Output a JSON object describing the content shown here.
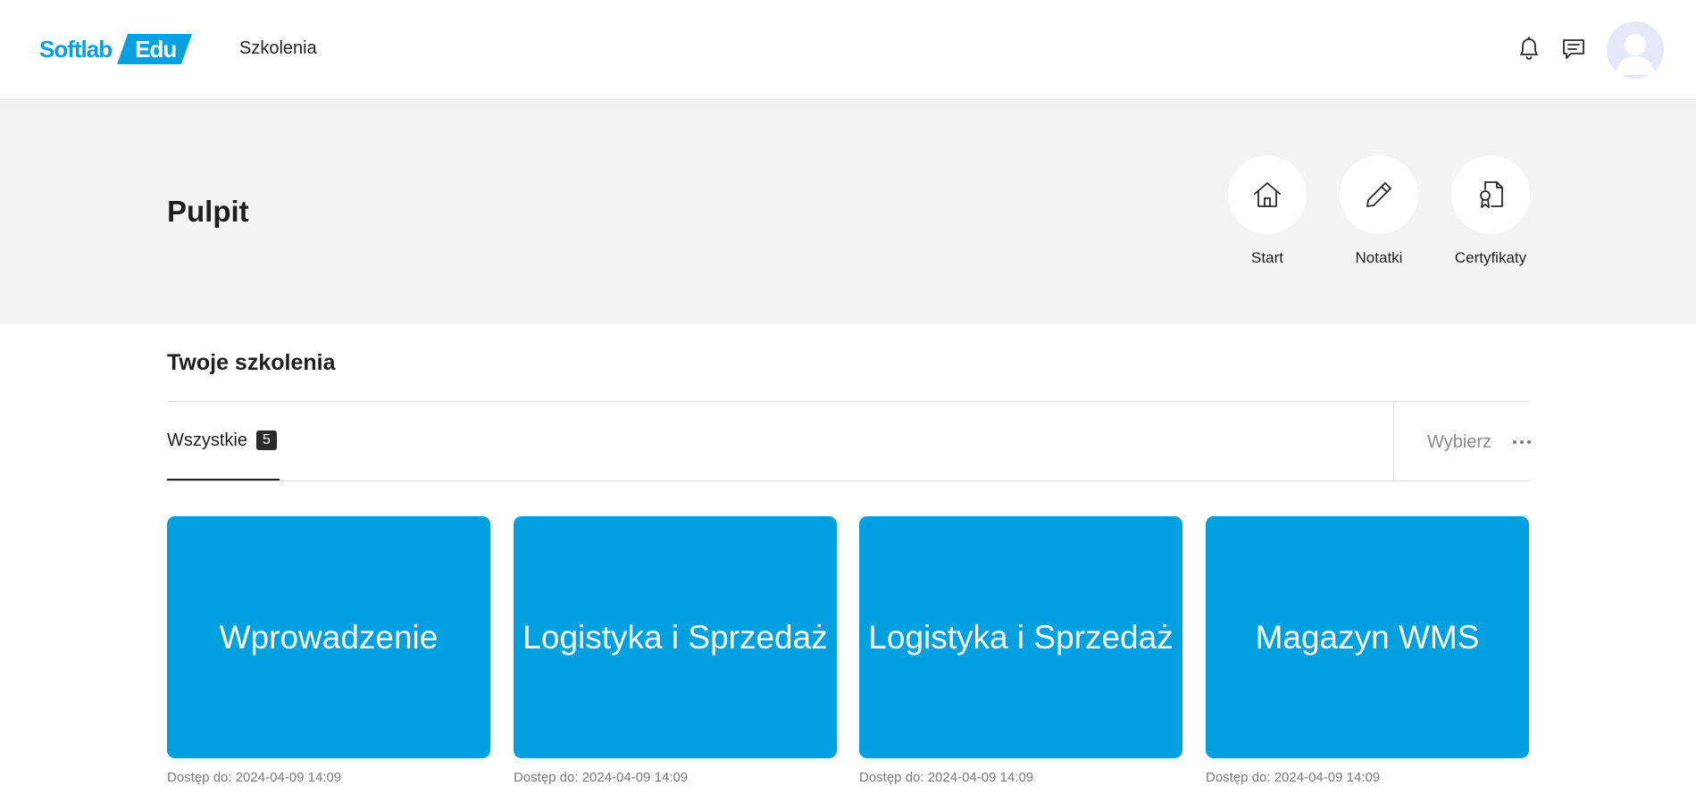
{
  "header": {
    "logo_part1": "Softlab",
    "logo_part2": "Edu",
    "nav_link": "Szkolenia",
    "icons": [
      "bell-icon",
      "chat-icon",
      "avatar"
    ]
  },
  "band": {
    "title": "Pulpit",
    "quick_links": [
      {
        "label": "Start",
        "icon": "home-icon"
      },
      {
        "label": "Notatki",
        "icon": "pencil-icon"
      },
      {
        "label": "Certyfikaty",
        "icon": "certificate-icon"
      }
    ]
  },
  "trainings": {
    "title": "Twoje szkolenia",
    "tab_label": "Wszystkie",
    "tab_count": "5",
    "select_label": "Wybierz",
    "cards": [
      {
        "title": "Wprowadzenie",
        "access": "Dostęp do: 2024-04-09 14:09"
      },
      {
        "title": "Logistyka i Sprzedaż",
        "access": "Dostęp do: 2024-04-09 14:09"
      },
      {
        "title": "Logistyka i Sprzedaż",
        "access": "Dostęp do: 2024-04-09 14:09"
      },
      {
        "title": "Magazyn WMS",
        "access": "Dostęp do: 2024-04-09 14:09"
      }
    ]
  },
  "colors": {
    "accent": "#03a0e0",
    "band_bg": "#f3f3f3",
    "avatar_bg": "#e4e8f8"
  }
}
